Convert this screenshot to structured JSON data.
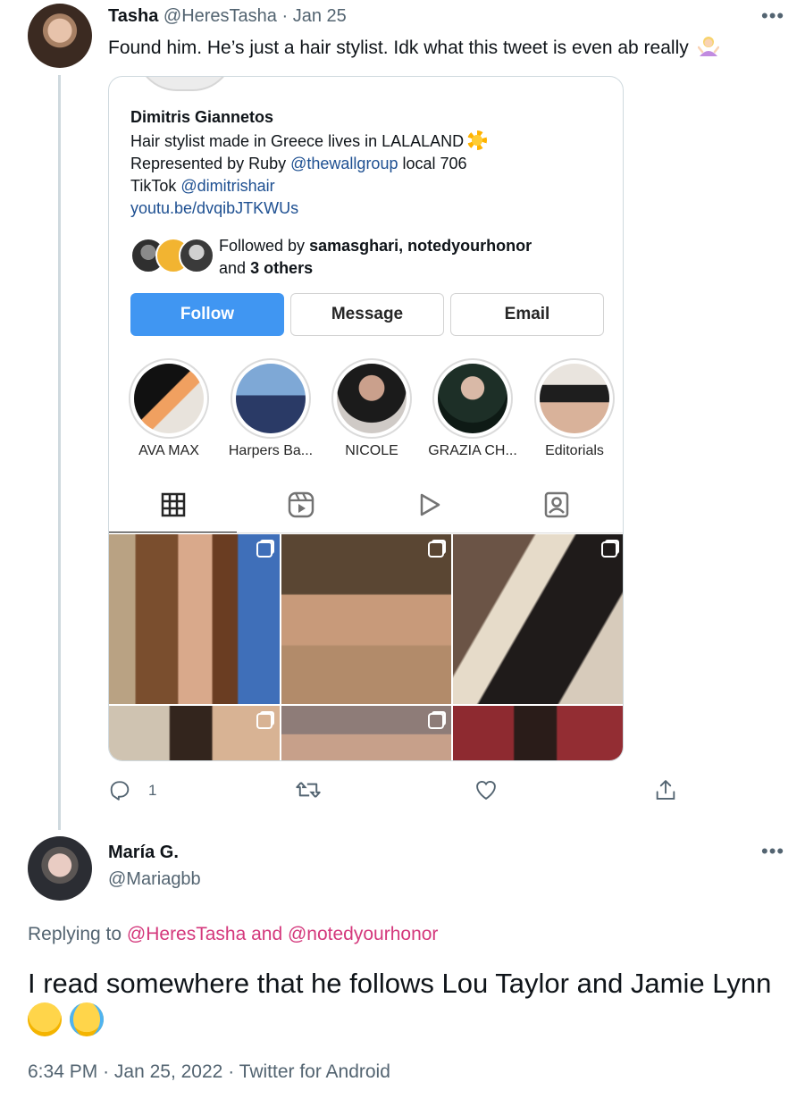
{
  "tweet1": {
    "display_name": "Tasha",
    "handle": "@HeresTasha",
    "date": "Jan 25",
    "text": "Found him. He’s just a hair stylist. Idk what this tweet is even ab really",
    "more_label": "•••",
    "reply_count": "1",
    "embedded_profile": {
      "name": "Dimitris Giannetos",
      "bio_line1": "Hair stylist made in Greece lives in LALALAND",
      "bio_line2_prefix": "Represented by Ruby",
      "bio_line2_link": "@thewallgroup",
      "bio_line2_suffix": "local 706",
      "bio_line3_prefix": "TikTok",
      "bio_line3_link": "@dimitrishair",
      "website": "youtu.be/dvqibJTKWUs",
      "followed_by_prefix": "Followed by",
      "followed_by_names": "samasghari, notedyourhonor",
      "followed_by_and": "and",
      "followed_by_others": "3 others",
      "buttons": {
        "follow": "Follow",
        "message": "Message",
        "email": "Email"
      },
      "highlights": [
        {
          "label": "AVA MAX"
        },
        {
          "label": "Harpers Ba..."
        },
        {
          "label": "NICOLE"
        },
        {
          "label": "GRAZIA CH..."
        },
        {
          "label": "Editorials"
        }
      ],
      "tabs": [
        "grid-icon",
        "reels-icon",
        "video-play-icon",
        "tagged-icon"
      ]
    }
  },
  "tweet2": {
    "display_name": "María G.",
    "handle": "@Mariagbb",
    "more_label": "•••",
    "replying_prefix": "Replying to",
    "replying_to": "@HeresTasha and @notedyourhonor",
    "text": "I read somewhere that he follows Lou Taylor and Jamie Lynn",
    "time": "6:34 PM",
    "date": "Jan 25, 2022",
    "source": "Twitter for Android"
  },
  "colors": {
    "link_blue": "#1d9bf0",
    "mention_pink": "#d4387c",
    "instagram_follow": "#4096f2",
    "muted": "#536471"
  }
}
